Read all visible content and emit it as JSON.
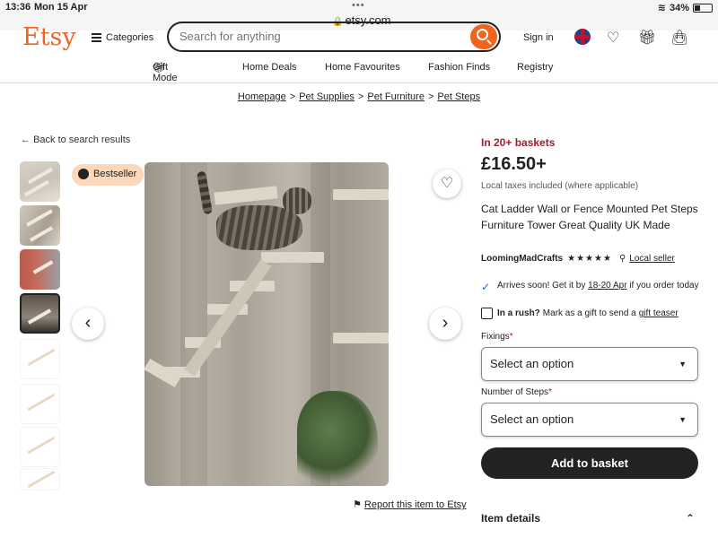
{
  "status_bar": {
    "time": "13:36",
    "date": "Mon 15 Apr",
    "url": "etsy.com",
    "battery": "34%"
  },
  "header": {
    "logo": "Etsy",
    "categories_label": "Categories",
    "search_placeholder": "Search for anything",
    "signin_label": "Sign in",
    "brand_color": "#f1641e",
    "icons": [
      "hamburger-icon",
      "search-icon",
      "flag-icon",
      "heart-icon",
      "gift-icon",
      "basket-icon"
    ]
  },
  "nav": {
    "items": [
      "Gift Mode",
      "Home Deals",
      "Home Favourites",
      "Fashion Finds",
      "Registry"
    ]
  },
  "breadcrumb": [
    "Homepage",
    "Pet Supplies",
    "Pet Furniture",
    "Pet Steps"
  ],
  "back_link": "Back to search results",
  "gallery": {
    "badge": "Bestseller",
    "report_link": "Report this item to Etsy"
  },
  "product": {
    "baskets": "In 20+ baskets",
    "price": "£16.50+",
    "tax_note": "Local taxes included (where applicable)",
    "title": "Cat Ladder Wall or Fence Mounted Pet Steps Furniture Tower Great Quality UK Made",
    "seller": "LoomingMadCrafts",
    "rating_stars": "★★★★★",
    "local_seller": "Local seller",
    "arrives_prefix": "Arrives soon! Get it by",
    "arrives_date": "18-20 Apr",
    "arrives_suffix": "if you order today",
    "rush_bold": "In a rush?",
    "rush_text": "Mark as a gift to send a",
    "rush_link": "gift teaser",
    "fixings_label": "Fixings",
    "steps_label": "Number of Steps",
    "required_mark": "*",
    "select_placeholder": "Select an option",
    "add_button": "Add to basket",
    "item_details": "Item details"
  }
}
